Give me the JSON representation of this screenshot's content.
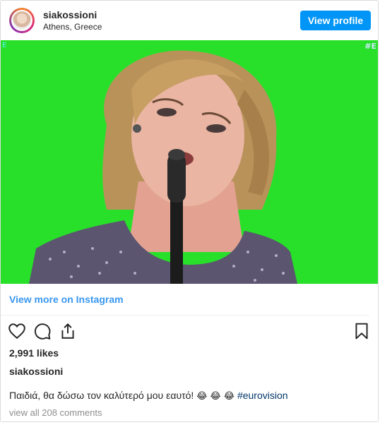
{
  "header": {
    "username": "siakossioni",
    "location": "Athens, Greece",
    "view_profile_label": "View profile"
  },
  "media": {
    "overlay_left": "E",
    "overlay_right": "#E"
  },
  "view_more_label": "View more on Instagram",
  "actions": {
    "like_icon": "heart-icon",
    "comment_icon": "comment-icon",
    "share_icon": "share-icon",
    "save_icon": "bookmark-icon"
  },
  "likes_text": "2,991 likes",
  "owner": "siakossioni",
  "caption": {
    "text": "Παιδιά, θα δώσω τον καλύτερό μου εαυτό! ",
    "emojis": "😂 😂 😂",
    "hashtag": "#eurovision"
  },
  "comments_link": "view all 208 comments",
  "colors": {
    "accent": "#0095f6",
    "link": "#3897f0",
    "hashtag": "#003569",
    "muted": "#8e8e8e",
    "media_background": "#28e02a"
  }
}
